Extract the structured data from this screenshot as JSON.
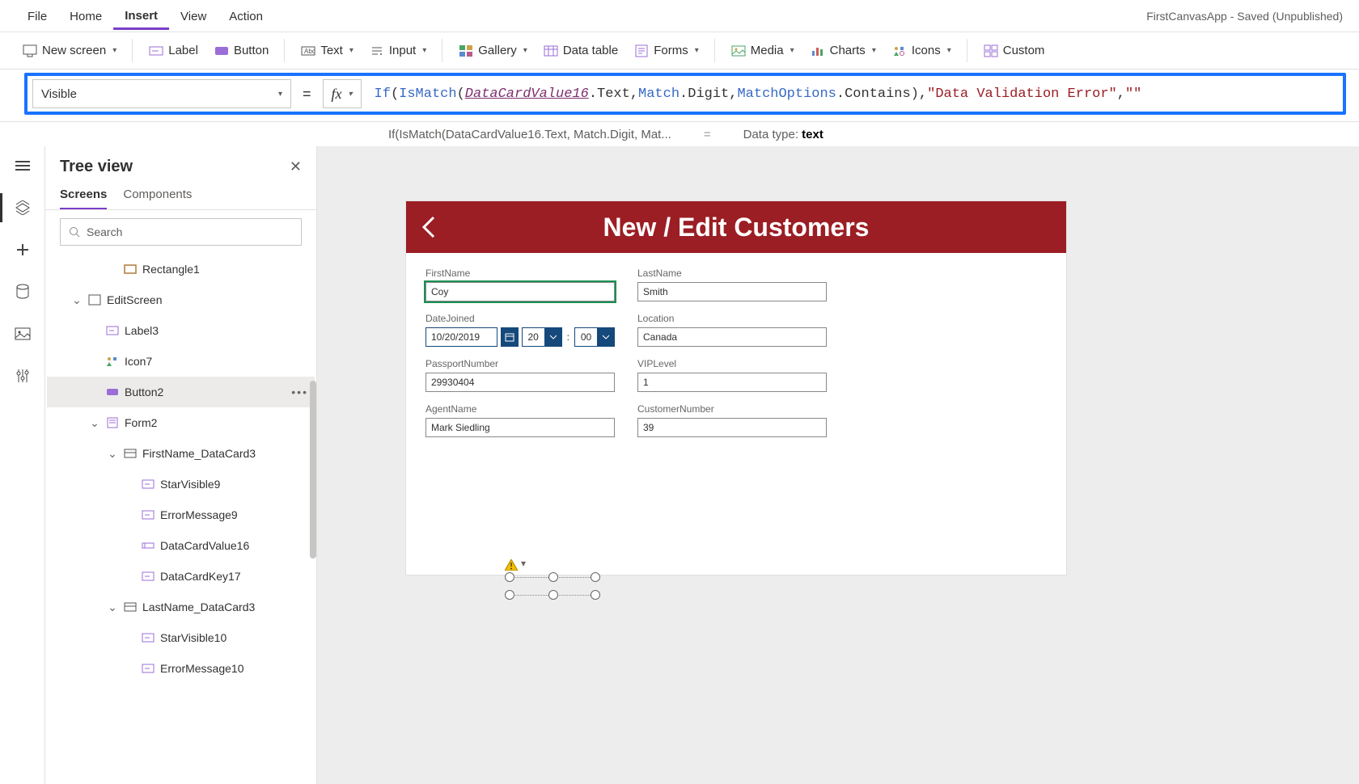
{
  "topmenu": {
    "items": [
      "File",
      "Home",
      "Insert",
      "View",
      "Action"
    ],
    "active": "Insert",
    "title": "FirstCanvasApp - Saved (Unpublished)"
  },
  "ribbon": {
    "new_screen": "New screen",
    "label": "Label",
    "button": "Button",
    "text": "Text",
    "input": "Input",
    "gallery": "Gallery",
    "datatable": "Data table",
    "forms": "Forms",
    "media": "Media",
    "charts": "Charts",
    "icons": "Icons",
    "custom": "Custom"
  },
  "formula": {
    "property": "Visible",
    "tokens": {
      "if": "If",
      "ismatch": "IsMatch",
      "dcv": "DataCardValue16",
      "text": ".Text",
      "c1": ", ",
      "match": "Match",
      "digit": ".Digit",
      "c2": ", ",
      "mo": "MatchOptions",
      "contains": ".Contains",
      "close": "), ",
      "str": "\"Data Validation Error\"",
      "c3": ", ",
      "empty": "\"\""
    },
    "preview": "If(IsMatch(DataCardValue16.Text, Match.Digit, Mat...",
    "preview_eq": "=",
    "datatype_label": "Data type: ",
    "datatype_val": "text"
  },
  "tree": {
    "title": "Tree view",
    "tabs": {
      "screens": "Screens",
      "components": "Components"
    },
    "search_ph": "Search",
    "items": [
      {
        "ind": 3,
        "icon": "rect",
        "label": "Rectangle1"
      },
      {
        "ind": 1,
        "icon": "screen",
        "label": "EditScreen",
        "tw": "v"
      },
      {
        "ind": 2,
        "icon": "lab",
        "label": "Label3"
      },
      {
        "ind": 2,
        "icon": "iconctl",
        "label": "Icon7"
      },
      {
        "ind": 2,
        "icon": "button",
        "label": "Button2",
        "sel": true,
        "more": true
      },
      {
        "ind": 2,
        "icon": "form",
        "label": "Form2",
        "tw": "v"
      },
      {
        "ind": 3,
        "icon": "card",
        "label": "FirstName_DataCard3",
        "tw": "v"
      },
      {
        "ind": 4,
        "icon": "lab",
        "label": "StarVisible9"
      },
      {
        "ind": 4,
        "icon": "lab",
        "label": "ErrorMessage9"
      },
      {
        "ind": 4,
        "icon": "input",
        "label": "DataCardValue16"
      },
      {
        "ind": 4,
        "icon": "lab",
        "label": "DataCardKey17"
      },
      {
        "ind": 3,
        "icon": "card",
        "label": "LastName_DataCard3",
        "tw": "v"
      },
      {
        "ind": 4,
        "icon": "lab",
        "label": "StarVisible10"
      },
      {
        "ind": 4,
        "icon": "lab",
        "label": "ErrorMessage10"
      }
    ]
  },
  "app": {
    "title": "New / Edit Customers",
    "fields": {
      "firstname": {
        "label": "FirstName",
        "value": "Coy"
      },
      "lastname": {
        "label": "LastName",
        "value": "Smith"
      },
      "datejoined": {
        "label": "DateJoined",
        "value": "10/20/2019",
        "hour": "20",
        "min": "00"
      },
      "location": {
        "label": "Location",
        "value": "Canada"
      },
      "passport": {
        "label": "PassportNumber",
        "value": "29930404"
      },
      "vip": {
        "label": "VIPLevel",
        "value": "1"
      },
      "agent": {
        "label": "AgentName",
        "value": "Mark Siedling"
      },
      "custno": {
        "label": "CustomerNumber",
        "value": "39"
      }
    }
  }
}
